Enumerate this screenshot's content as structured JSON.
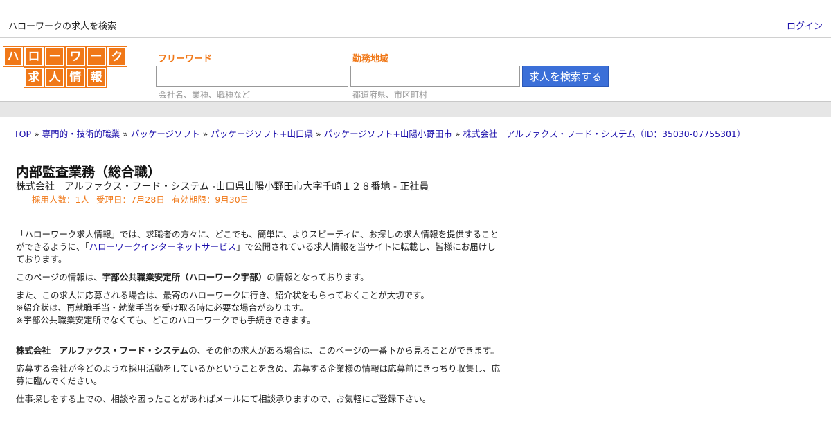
{
  "topbar": {
    "site_desc": "ハローワークの求人を検索",
    "login": "ログイン"
  },
  "logo": {
    "row1": [
      "ハ",
      "ロ",
      "ー",
      "ワ",
      "ー",
      "ク"
    ],
    "row2": [
      "求",
      "人",
      "情",
      "報"
    ],
    "color": "#f07818"
  },
  "search": {
    "free_label": "フリーワード",
    "free_value": "",
    "free_hint": "会社名、業種、職種など",
    "area_label": "勤務地域",
    "area_value": "",
    "area_hint": "都道府県、市区町村",
    "button": "求人を検索する",
    "button_color": "#3b6fd8"
  },
  "breadcrumb": {
    "sep": "»",
    "items": [
      "TOP",
      "専門的・技術的職業",
      "パッケージソフト",
      "パッケージソフト+山口県",
      "パッケージソフト+山陽小野田市",
      "株式会社　アルファクス・フード・システム（ID：35030-07755301）"
    ]
  },
  "job": {
    "title": "内部監査業務（総合職）",
    "subtitle": "株式会社　アルファクス・フード・システム -山口県山陽小野田市大字千崎１２８番地 - 正社員",
    "hires": "採用人数：1人",
    "received": "受理日：7月28日",
    "expires": "有効期限：9月30日"
  },
  "content": {
    "p1_a": "「ハローワーク求人情報」では、求職者の方々に、どこでも、簡単に、よりスピーディに、お探しの求人情報を提供することができるように、「",
    "p1_link": "ハローワークインターネットサービス",
    "p1_b": "」で公開されている求人情報を当サイトに転載し、皆様にお届けしております。",
    "p2_a": "このページの情報は、",
    "p2_bold": "宇部公共職業安定所（ハローワーク宇部）",
    "p2_b": "の情報となっております。",
    "p3_line1": "また、この求人に応募される場合は、最寄のハローワークに行き、紹介状をもらっておくことが大切です。",
    "p3_line2": "※紹介状は、再就職手当・就業手当を受け取る時に必要な場合があります。",
    "p3_line3": "※宇部公共職業安定所でなくても、どこのハローワークでも手続きできます。",
    "p4_bold": "株式会社　アルファクス・フード・システム",
    "p4_rest": "の、その他の求人がある場合は、このページの一番下から見ることができます。",
    "p5": "応募する会社が今どのような採用活動をしているかということを含め、応募する企業様の情報は応募前にきっちり収集し、応募に臨んでください。",
    "p6": "仕事探しをする上での、相談や困ったことがあればメールにて相談承りますので、お気軽にご登録下さい。"
  }
}
